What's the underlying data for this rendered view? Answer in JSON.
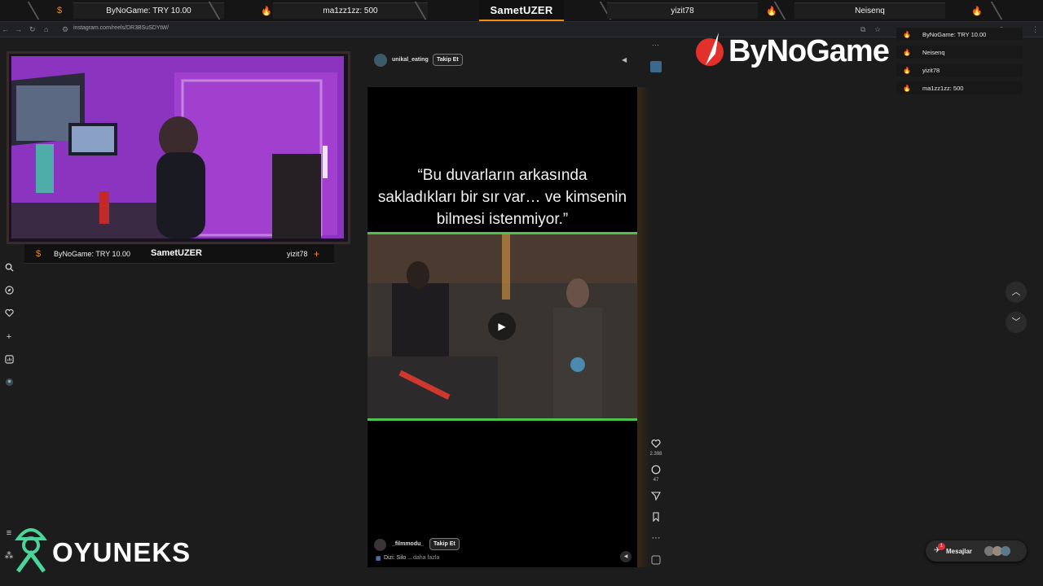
{
  "overlay": {
    "segments": [
      {
        "icon": "$",
        "label": "ByNoGame: TRY 10.00"
      },
      {
        "icon": "🔥",
        "label": "ma1zz1zz: 500"
      },
      {
        "label": "SametUZER"
      },
      {
        "label": "yizit78"
      },
      {
        "label": "Neisenq"
      }
    ]
  },
  "browser": {
    "url": "instagram.com/reels/DR3BSuSDYtW/"
  },
  "webcam_bar": {
    "donation": "ByNoGame: TRY 10.00",
    "streamer": "SametUZER",
    "follower": "yizit78"
  },
  "reel_header": {
    "username": "unikal_eating",
    "follow_label": "Takip Et"
  },
  "reel": {
    "caption_line1": "“Bu duvarların arkasında",
    "caption_line2": "sakladıkları bir sır var… ve kimsenin",
    "caption_line3": "bilmesi istenmiyor.”",
    "author": "_filmmodu_",
    "follow_label": "Takip Et",
    "description": "Dizi: Silo ...",
    "more_label": "daha fazla"
  },
  "actions": {
    "likes": "2.398",
    "comments": "47"
  },
  "brand": {
    "bynogame": "ByNoGame",
    "oyuneks": "OYUNEKS"
  },
  "chat": {
    "items": [
      "ByNoGame: TRY 10.00",
      "Neisenq",
      "yizit78",
      "ma1zz1zz: 500"
    ]
  },
  "messages": {
    "label": "Mesajlar",
    "badge": "1"
  }
}
